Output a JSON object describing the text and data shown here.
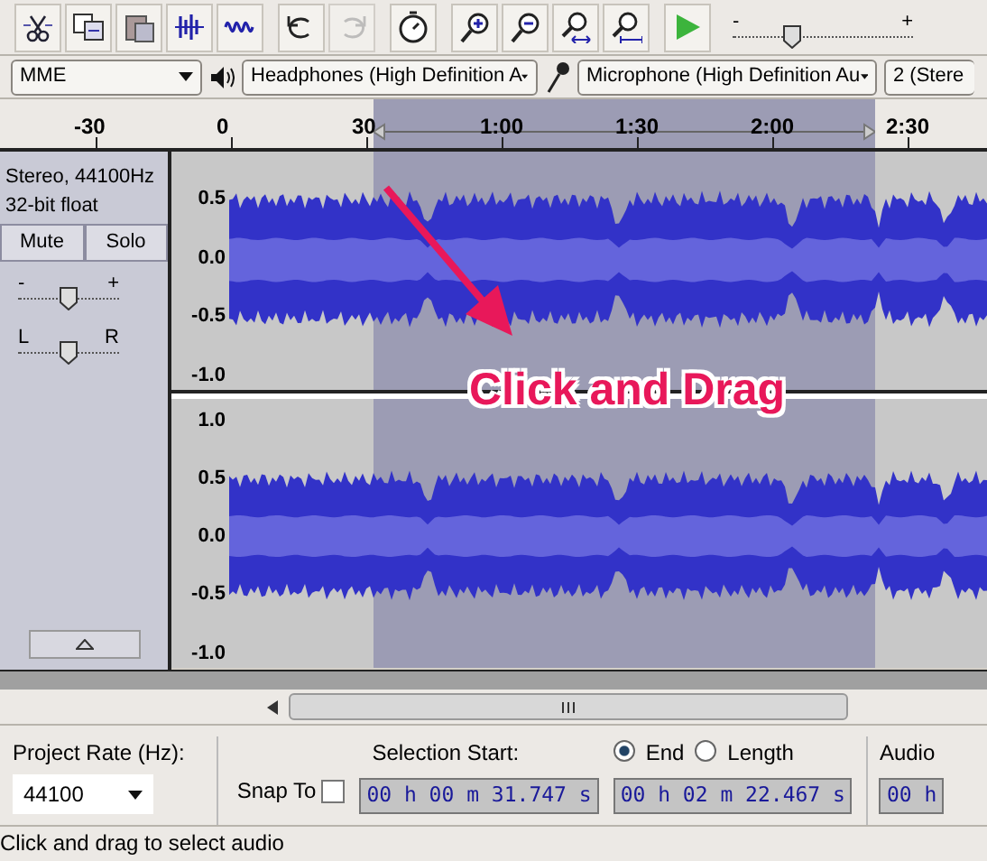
{
  "toolbar": {
    "buttons": [
      {
        "kind": "trim",
        "disabled": false
      },
      {
        "kind": "copy",
        "disabled": false
      },
      {
        "kind": "paste",
        "disabled": false
      },
      {
        "kind": "trim-audio",
        "disabled": false
      },
      {
        "kind": "silence",
        "disabled": false
      },
      {
        "kind": "undo",
        "disabled": false
      },
      {
        "kind": "redo",
        "disabled": true
      },
      {
        "kind": "timer",
        "disabled": false
      },
      {
        "kind": "zoom-in",
        "disabled": false
      },
      {
        "kind": "zoom-out",
        "disabled": false
      },
      {
        "kind": "fit-selection",
        "disabled": false
      },
      {
        "kind": "fit-project",
        "disabled": false
      },
      {
        "kind": "play",
        "disabled": false
      }
    ],
    "speed_slider": {
      "min_label": "-",
      "max_label": "+",
      "level": 0.33
    }
  },
  "device_bar": {
    "host": "MME",
    "output": "Headphones (High Definition A",
    "input": "Microphone (High Definition Au",
    "channels": "2 (Stere"
  },
  "ruler": {
    "labels": [
      "-30",
      "0",
      "30",
      "1:00",
      "1:30",
      "2:00",
      "2:30"
    ]
  },
  "track": {
    "info": [
      "Stereo, 44100Hz",
      "32-bit float"
    ],
    "mute": "Mute",
    "solo": "Solo",
    "gain": {
      "min_label": "-",
      "max_label": "+",
      "level": 0.5
    },
    "pan": {
      "min_label": "L",
      "max_label": "R",
      "level": 0.5
    },
    "channels": [
      {
        "scale": [
          "0.5",
          "0.0",
          "-0.5",
          "-1.0"
        ]
      },
      {
        "scale": [
          "1.0",
          "0.5",
          "0.0",
          "-0.5",
          "-1.0"
        ]
      }
    ]
  },
  "annotation": {
    "text": "Click and Drag"
  },
  "selection_bar": {
    "rate_label": "Project Rate (Hz):",
    "rate": "44100",
    "snap_label": "Snap To",
    "snap_checked": false,
    "start_label": "Selection Start:",
    "modes": [
      {
        "label": "End",
        "selected": true
      },
      {
        "label": "Length",
        "selected": false
      }
    ],
    "position_label": "Audio",
    "start": "00 h 00 m 31.747 s",
    "end": "00 h 02 m 22.467 s",
    "position": "00 h"
  },
  "status_bar": "Click and drag to select audio"
}
